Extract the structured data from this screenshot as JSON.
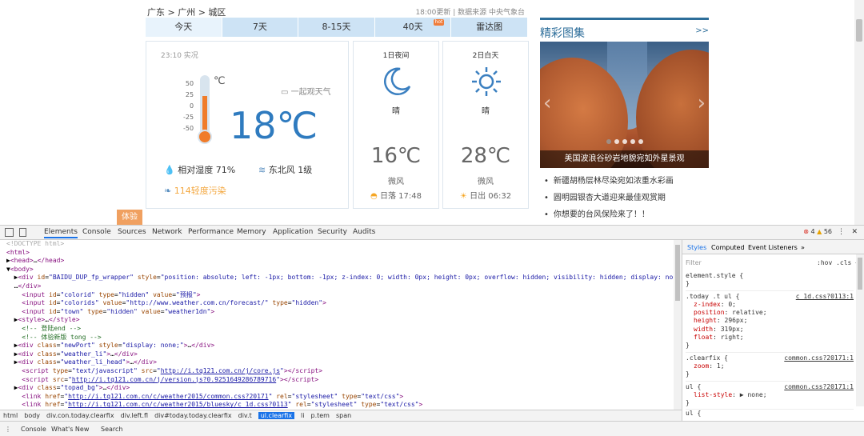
{
  "breadcrumb": "广东 > 广州 > 城区",
  "update": "18:00更新 | 数据来源 中央气象台",
  "tabs": [
    "今天",
    "7天",
    "8-15天",
    "40天",
    "雷达图"
  ],
  "hot": "hot",
  "now": {
    "time": "23:10 实况",
    "scale": [
      "50",
      "25",
      "0",
      "-25",
      "-50"
    ],
    "unit": "℃",
    "temp": "18℃",
    "share": "一起观天气",
    "humidity": "相对湿度  71%",
    "wind": "东北风  1级",
    "aqi": "114轻度污染"
  },
  "days": [
    {
      "label": "1日夜间",
      "cond": "晴",
      "temp": "16℃",
      "wind": "微风",
      "sun": "日落 17:48",
      "icon": "moon-icon"
    },
    {
      "label": "2日白天",
      "cond": "晴",
      "temp": "28℃",
      "wind": "微风",
      "sun": "日出 06:32",
      "icon": "sun-icon"
    }
  ],
  "experience": "体验",
  "gallery": {
    "title": "精彩图集",
    "more": ">>",
    "caption": "美国波浪谷砂岩地貌宛如外星景观"
  },
  "news": [
    "新疆胡杨层林尽染宛如浓重水彩画",
    "圆明园银杏大道迎来最佳观赏期",
    "你想要的台风保险来了！！"
  ],
  "devtools": {
    "tabs": [
      "Elements",
      "Console",
      "Sources",
      "Network",
      "Performance",
      "Memory",
      "Application",
      "Security",
      "Audits"
    ],
    "errors": "4",
    "warnings": "56",
    "breadcrumbs": [
      "html",
      "body",
      "div.con.today.clearfix",
      "div.left.fl",
      "div#today.today.clearfix",
      "div.t",
      "ul.clearfix",
      "li",
      "p.tem",
      "span"
    ],
    "side_tabs": [
      "Styles",
      "Computed",
      "Event Listeners",
      "»"
    ],
    "filter": "Filter",
    "hov": ":hov  .cls  +",
    "drawer": [
      "Console",
      "What's New",
      "Search"
    ]
  }
}
